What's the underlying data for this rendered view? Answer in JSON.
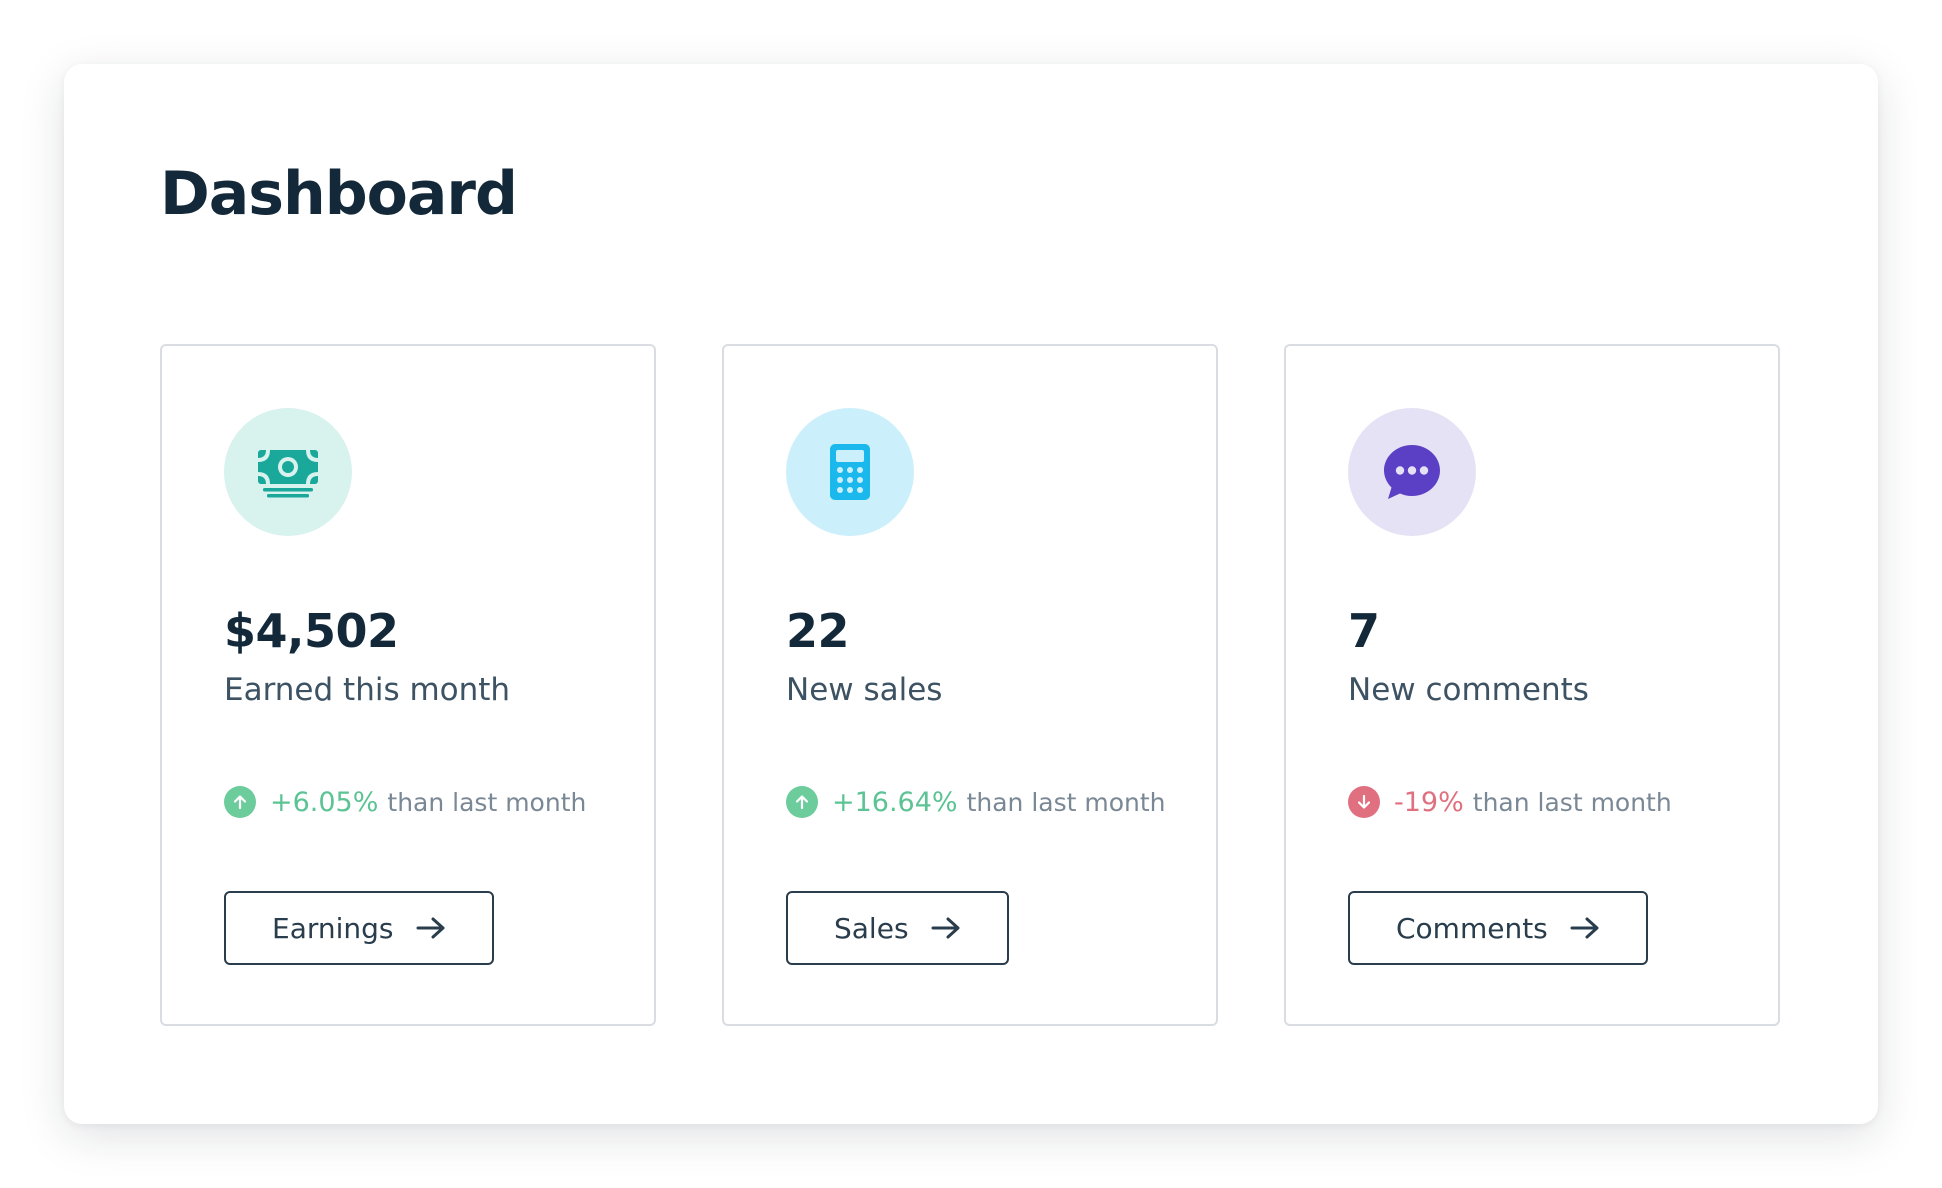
{
  "page": {
    "title": "Dashboard"
  },
  "cards": [
    {
      "icon": "money-icon",
      "icon_color": "#1aa89a",
      "icon_bg": "#d8f2ee",
      "value": "$4,502",
      "label": "Earned this month",
      "trend_direction": "up",
      "trend_value": "+6.05%",
      "trend_suffix": "than last month",
      "button_label": "Earnings"
    },
    {
      "icon": "calculator-icon",
      "icon_color": "#1ab8ec",
      "icon_bg": "#ccf0fb",
      "value": "22",
      "label": "New sales",
      "trend_direction": "up",
      "trend_value": "+16.64%",
      "trend_suffix": "than last month",
      "button_label": "Sales"
    },
    {
      "icon": "chat-bubble-icon",
      "icon_color": "#5b3fc4",
      "icon_bg": "#e6e2f6",
      "value": "7",
      "label": "New comments",
      "trend_direction": "down",
      "trend_value": "-19%",
      "trend_suffix": "than last month",
      "button_label": "Comments"
    }
  ],
  "colors": {
    "trend_up": "#5cc394",
    "trend_down": "#e0707f",
    "heading": "#13293a",
    "card_border": "#d9dde2"
  }
}
